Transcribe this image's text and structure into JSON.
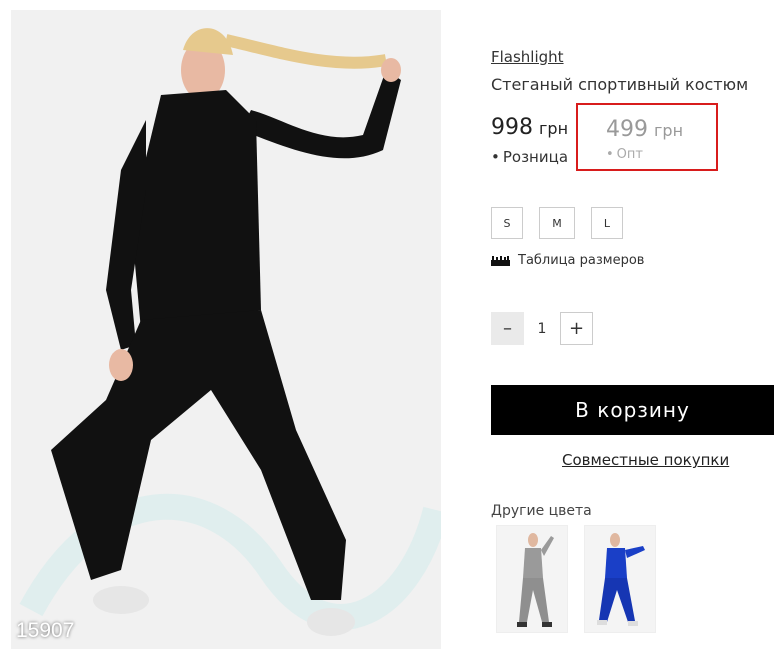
{
  "product": {
    "brand": "Flashlight",
    "title": "Стеганый спортивный костюм",
    "photo_id": "15907",
    "photo_alt": "woman in black quilted sports suit"
  },
  "prices": {
    "retail": {
      "value": "998",
      "currency": "грн",
      "label": "Розница"
    },
    "wholesale": {
      "value": "499",
      "currency": "грн",
      "label": "Опт",
      "highlight_color": "#d81c1c"
    }
  },
  "sizes": [
    "S",
    "M",
    "L"
  ],
  "size_table_label": "Таблица размеров",
  "quantity": {
    "minus": "–",
    "value": "1",
    "plus": "+"
  },
  "cart_button_label": "В корзину",
  "joint_purchase_label": "Совместные покупки",
  "other_colors": {
    "label": "Другие цвета",
    "items": [
      {
        "name": "gray",
        "color": "#9a9a9a"
      },
      {
        "name": "blue",
        "color": "#1a3fc7"
      }
    ]
  }
}
